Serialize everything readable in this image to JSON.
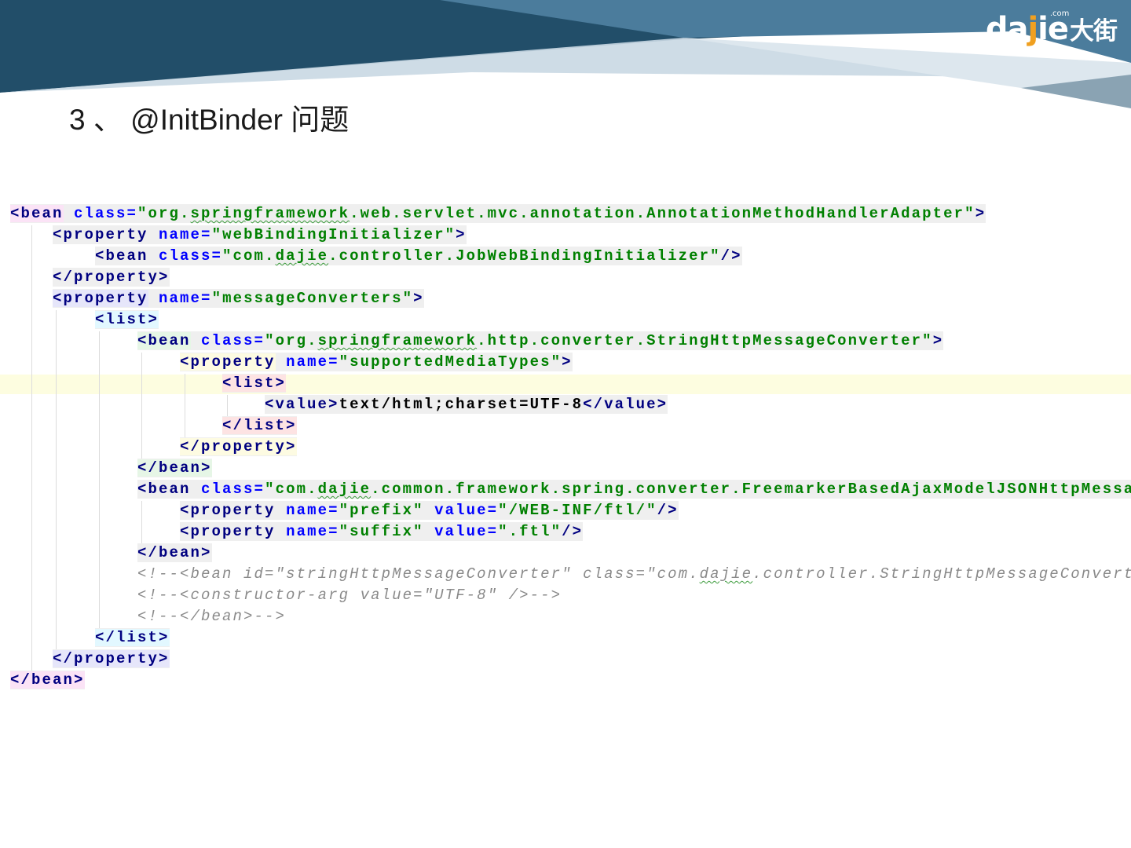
{
  "slide": {
    "title": "3 、 @InitBinder 问题",
    "logo": {
      "text_a": "da",
      "text_j": "j",
      "text_b": "ie",
      "com": ".com",
      "cn": "大街"
    }
  },
  "colors": {
    "tag": "#000080",
    "attr": "#0000ff",
    "value": "#008000",
    "comment": "#8a8a8a",
    "line_bg": "#efefef",
    "current_line": "#fdfde0"
  },
  "code": {
    "lines": [
      {
        "indent": 0,
        "tagbg": "#fbe3f6",
        "tokens": [
          [
            "t",
            "<bean"
          ],
          [
            "a",
            " class="
          ],
          [
            "v",
            "\"org."
          ],
          [
            "vu",
            "springframework"
          ],
          [
            "v",
            ".web.servlet.mvc.annotation.AnnotationMethodHandlerAdapter\""
          ],
          [
            "t",
            ">"
          ]
        ]
      },
      {
        "indent": 1,
        "tagbg": "#efefef",
        "tokens": [
          [
            "t",
            "<property"
          ],
          [
            "a",
            " name="
          ],
          [
            "v",
            "\"webBindingInitializer\""
          ],
          [
            "t",
            ">"
          ]
        ]
      },
      {
        "indent": 2,
        "tagbg": "#efefef",
        "tokens": [
          [
            "t",
            "<bean"
          ],
          [
            "a",
            " class="
          ],
          [
            "v",
            "\"com."
          ],
          [
            "vu",
            "dajie"
          ],
          [
            "v",
            ".controller.JobWebBindingInitializer\""
          ],
          [
            "t",
            "/>"
          ]
        ]
      },
      {
        "indent": 1,
        "tagbg": "#efefef",
        "tokens": [
          [
            "t",
            "</property>"
          ]
        ]
      },
      {
        "indent": 1,
        "tagbg": "#e6e6fa",
        "tokens": [
          [
            "t",
            "<property"
          ],
          [
            "a",
            " name="
          ],
          [
            "v",
            "\"messageConverters\""
          ],
          [
            "t",
            ">"
          ]
        ]
      },
      {
        "indent": 2,
        "tagbg": "#e2f8ff",
        "tokens": [
          [
            "t",
            "<list>"
          ]
        ]
      },
      {
        "indent": 3,
        "tagbg": "#e6f6e6",
        "tokens": [
          [
            "t",
            "<bean"
          ],
          [
            "a",
            " class="
          ],
          [
            "v",
            "\"org."
          ],
          [
            "vu",
            "springframework"
          ],
          [
            "v",
            ".http.converter.StringHttpMessageConverter\""
          ],
          [
            "t",
            ">"
          ]
        ]
      },
      {
        "indent": 4,
        "tagbg": "#fdfbe2",
        "tokens": [
          [
            "t",
            "<property"
          ],
          [
            "a",
            " name="
          ],
          [
            "v",
            "\"supportedMediaTypes\""
          ],
          [
            "t",
            ">"
          ]
        ]
      },
      {
        "indent": 5,
        "tagbg": "#fde3e3",
        "tokens": [
          [
            "t",
            "<list>"
          ]
        ]
      },
      {
        "indent": 6,
        "tagbg": "#efefef",
        "tokens": [
          [
            "t",
            "<value>"
          ],
          [
            "x",
            "text/html;charset=UTF-8"
          ],
          [
            "t",
            "</value>"
          ]
        ]
      },
      {
        "indent": 5,
        "tagbg": "#fde3e3",
        "tokens": [
          [
            "t",
            "</list>"
          ]
        ]
      },
      {
        "indent": 4,
        "tagbg": "#fdfbe2",
        "tokens": [
          [
            "t",
            "</property>"
          ]
        ]
      },
      {
        "indent": 3,
        "tagbg": "#e6f6e6",
        "tokens": [
          [
            "t",
            "</bean>"
          ]
        ]
      },
      {
        "indent": 3,
        "tagbg": "#efefef",
        "tokens": [
          [
            "t",
            "<bean"
          ],
          [
            "a",
            " class="
          ],
          [
            "v",
            "\"com."
          ],
          [
            "vu",
            "dajie"
          ],
          [
            "v",
            ".common.framework.spring.converter.FreemarkerBasedAjaxModelJSONHttpMessa"
          ]
        ]
      },
      {
        "indent": 4,
        "tagbg": "#efefef",
        "tokens": [
          [
            "t",
            "<property"
          ],
          [
            "a",
            " name="
          ],
          [
            "v",
            "\"prefix\""
          ],
          [
            "a",
            " value="
          ],
          [
            "v",
            "\"/WEB-INF/ftl/\""
          ],
          [
            "t",
            "/>"
          ]
        ]
      },
      {
        "indent": 4,
        "tagbg": "#efefef",
        "tokens": [
          [
            "t",
            "<property"
          ],
          [
            "a",
            " name="
          ],
          [
            "v",
            "\"suffix\""
          ],
          [
            "a",
            " value="
          ],
          [
            "v",
            "\".ftl\""
          ],
          [
            "t",
            "/>"
          ]
        ]
      },
      {
        "indent": 3,
        "tagbg": "#efefef",
        "tokens": [
          [
            "t",
            "</bean>"
          ]
        ]
      },
      {
        "indent": 3,
        "tagbg": "transparent",
        "tokens": [
          [
            "c",
            "<!--<bean id=\"stringHttpMessageConverter\" class=\"com."
          ],
          [
            "cu",
            "dajie"
          ],
          [
            "c",
            ".controller.StringHttpMessageConvert"
          ]
        ]
      },
      {
        "indent": 3,
        "tagbg": "transparent",
        "tokens": [
          [
            "c",
            "<!--<constructor-arg value=\"UTF-8\" />-->"
          ]
        ]
      },
      {
        "indent": 3,
        "tagbg": "transparent",
        "tokens": [
          [
            "c",
            "<!--</bean>-->"
          ]
        ]
      },
      {
        "indent": 2,
        "tagbg": "#e2f8ff",
        "tokens": [
          [
            "t",
            "</list>"
          ]
        ]
      },
      {
        "indent": 1,
        "tagbg": "#e6e6fa",
        "tokens": [
          [
            "t",
            "</property>"
          ]
        ]
      },
      {
        "indent": 0,
        "tagbg": "#fbe3f6",
        "tokens": [
          [
            "t",
            "</bean>"
          ]
        ]
      }
    ]
  }
}
